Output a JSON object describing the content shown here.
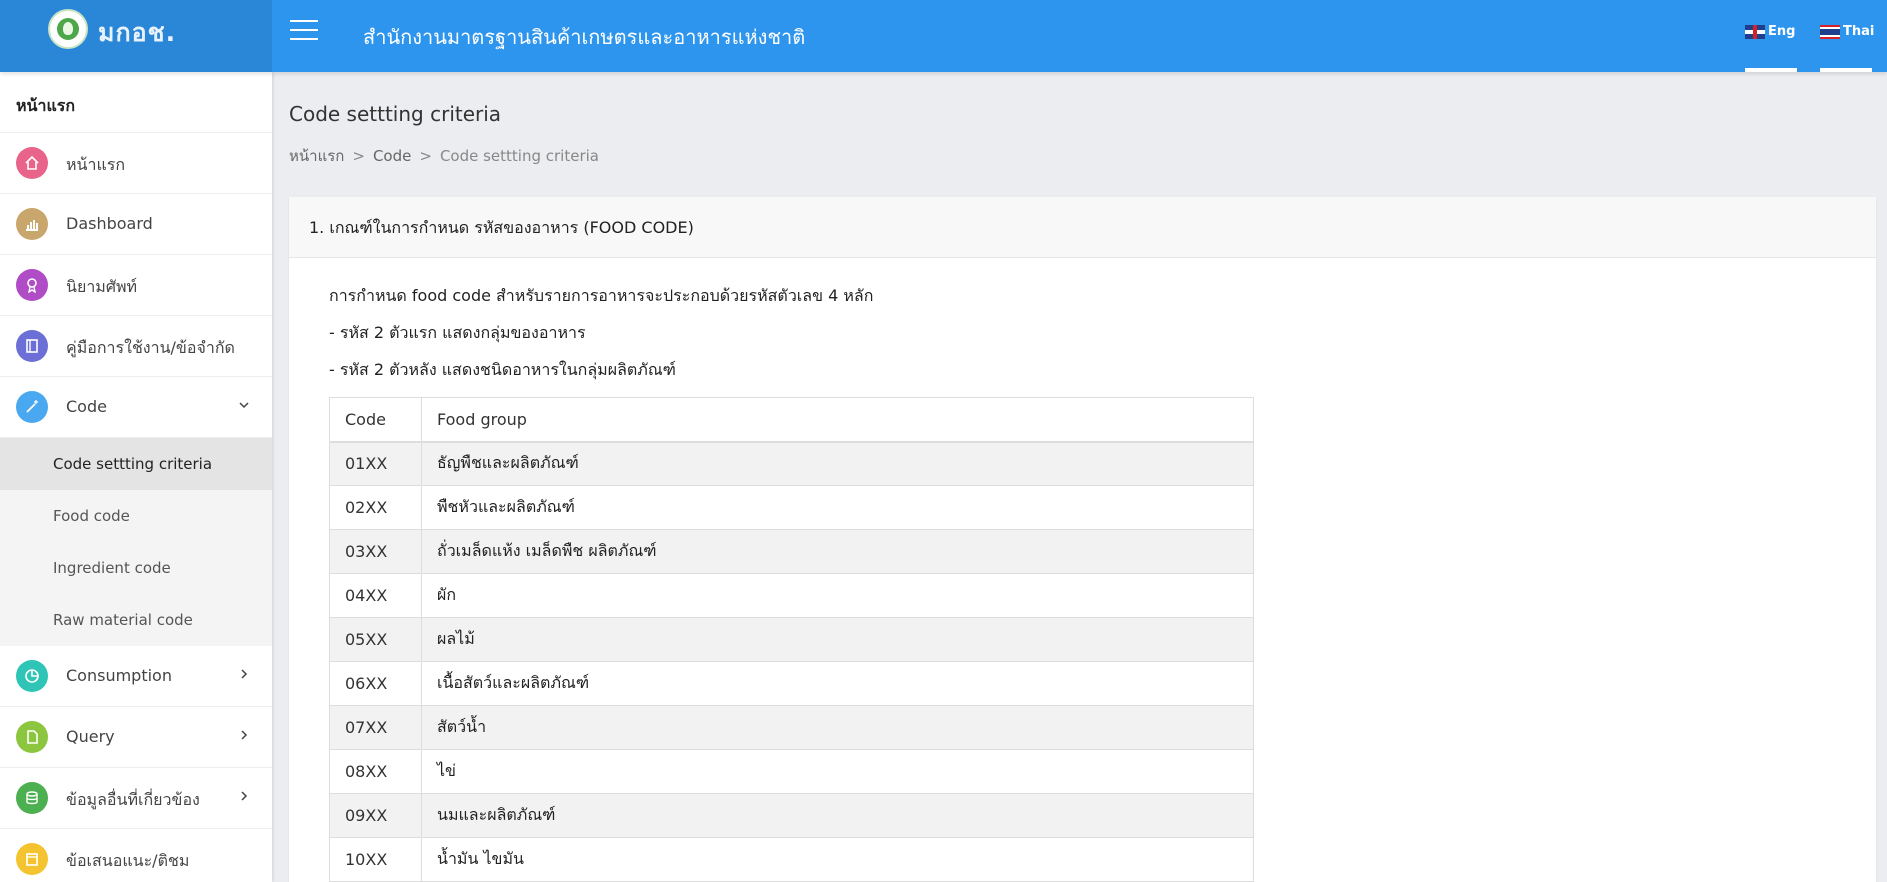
{
  "header": {
    "brand_name": "มกอช.",
    "site_title": "สำนักงานมาตรฐานสินค้าเกษตรและอาหารแห่งชาติ",
    "lang_en": "Eng",
    "lang_th": "Thai"
  },
  "sidebar": {
    "header": "หน้าแรก",
    "items": [
      {
        "label": "หน้าแรก",
        "icon": "home-icon",
        "color": "#e9648a"
      },
      {
        "label": "Dashboard",
        "icon": "bar-chart-icon",
        "color": "#c9a66b"
      },
      {
        "label": "นิยามศัพท์",
        "icon": "ribbon-icon",
        "color": "#b04cc6"
      },
      {
        "label": "คู่มือการใช้งาน/ข้อจำกัด",
        "icon": "book-icon",
        "color": "#6c6fd6"
      },
      {
        "label": "Code",
        "icon": "magic-wand-icon",
        "color": "#4aa8f0"
      }
    ],
    "code_sub": [
      {
        "label": "Code settting criteria"
      },
      {
        "label": "Food code"
      },
      {
        "label": "Ingredient code"
      },
      {
        "label": "Raw material code"
      }
    ],
    "items2": [
      {
        "label": "Consumption",
        "icon": "pie-chart-icon",
        "color": "#2ec5b6"
      },
      {
        "label": "Query",
        "icon": "document-icon",
        "color": "#8cc63f"
      },
      {
        "label": "ข้อมูลอื่นที่เกี่ยวข้อง",
        "icon": "database-icon",
        "color": "#4caf50"
      },
      {
        "label": "ข้อเสนอแนะ/ติชม",
        "icon": "note-icon",
        "color": "#f4c430"
      }
    ]
  },
  "main": {
    "title": "Code settting criteria",
    "breadcrumb": [
      "หน้าแรก",
      "Code",
      "Code settting criteria"
    ],
    "card_title": "1. เกณฑ์ในการกำหนด รหัสของอาหาร (FOOD CODE)",
    "paragraphs": [
      "การกำหนด food code สำหรับรายการอาหารจะประกอบด้วยรหัสตัวเลข 4 หลัก",
      "- รหัส 2 ตัวแรก แสดงกลุ่มของอาหาร",
      "- รหัส 2 ตัวหลัง แสดงชนิดอาหารในกลุ่มผลิตภัณฑ์"
    ],
    "table": {
      "headers": [
        "Code",
        "Food group"
      ],
      "rows": [
        [
          "01XX",
          "ธัญพืชและผลิตภัณฑ์"
        ],
        [
          "02XX",
          "พืชหัวและผลิตภัณฑ์"
        ],
        [
          "03XX",
          "ถั่วเมล็ดแห้ง เมล็ดพืช ผลิตภัณฑ์"
        ],
        [
          "04XX",
          "ผัก"
        ],
        [
          "05XX",
          "ผลไม้"
        ],
        [
          "06XX",
          "เนื้อสัตว์และผลิตภัณฑ์"
        ],
        [
          "07XX",
          "สัตว์น้ำ"
        ],
        [
          "08XX",
          "ไข่"
        ],
        [
          "09XX",
          "นมและผลิตภัณฑ์"
        ],
        [
          "10XX",
          "น้ำมัน ไขมัน"
        ]
      ]
    }
  }
}
